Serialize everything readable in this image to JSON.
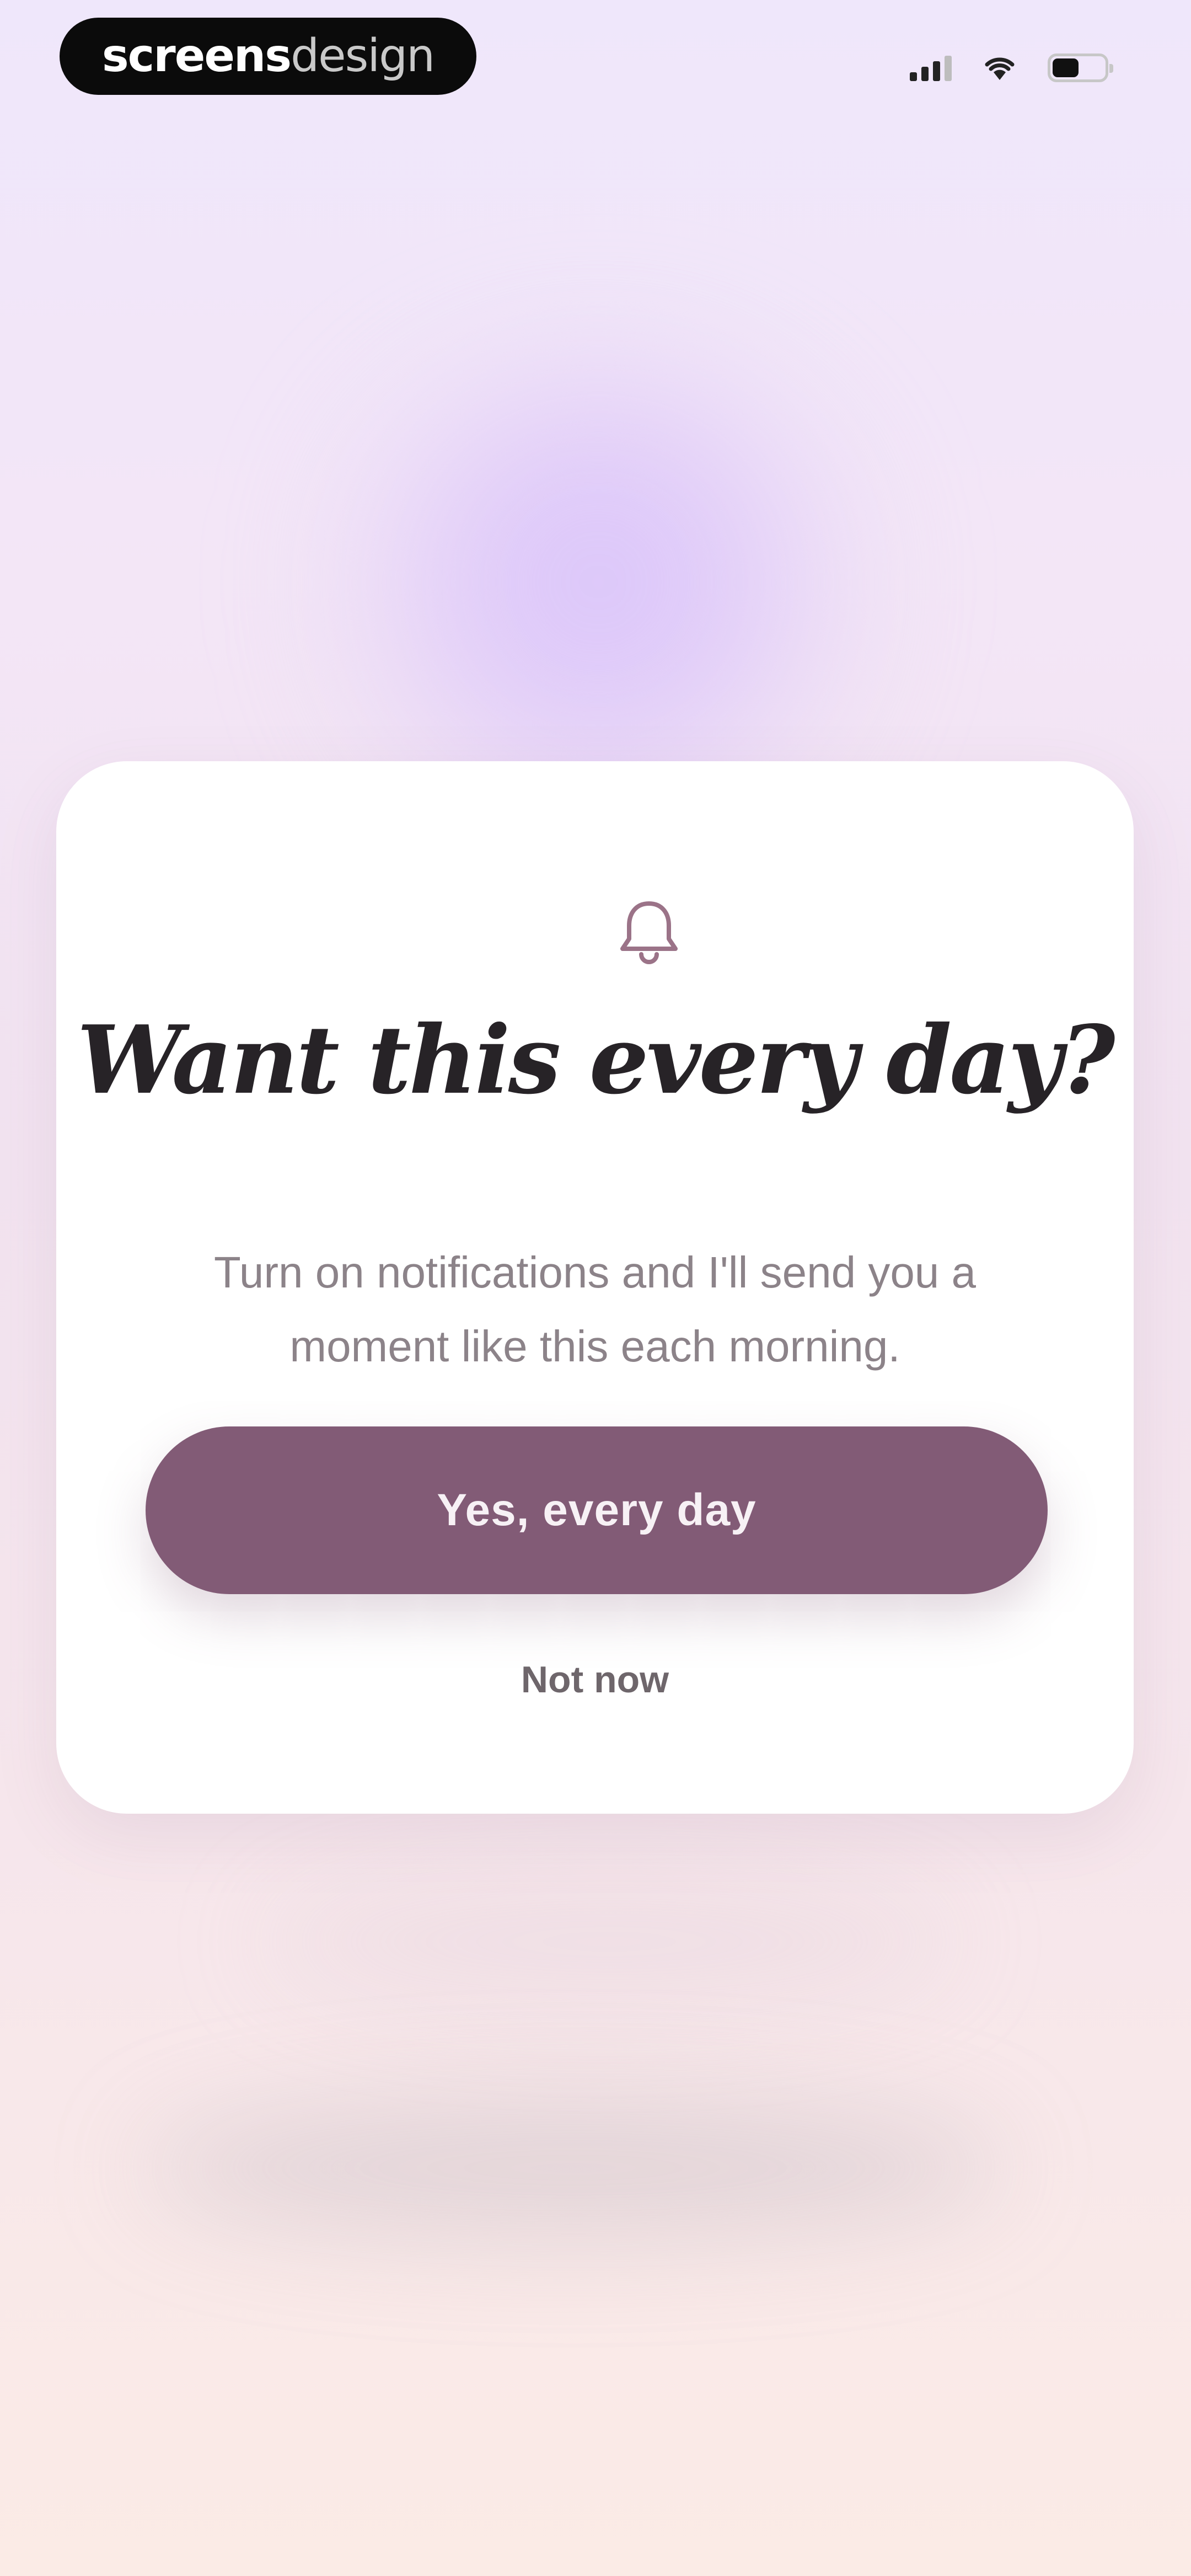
{
  "status_bar": {
    "logo": {
      "part_bold": "screens",
      "part_light": "design"
    },
    "icons": [
      "cellular-signal-icon",
      "wifi-icon",
      "battery-icon"
    ],
    "battery_level_percent": 55
  },
  "modal": {
    "icon": "bell-icon",
    "title": "Want this every day?",
    "body": "Turn on notifications and I'll send you a moment like this each morning.",
    "primary_button_label": "Yes, every day",
    "secondary_button_label": "Not now"
  },
  "colors": {
    "primary_button": "#825b76",
    "bell_icon": "#9b7388",
    "title_text": "#272327",
    "body_text": "#8c8389",
    "background_top": "#efe7fb",
    "background_bottom": "#fbebe6",
    "accent_glow": "#d8c2fb"
  }
}
